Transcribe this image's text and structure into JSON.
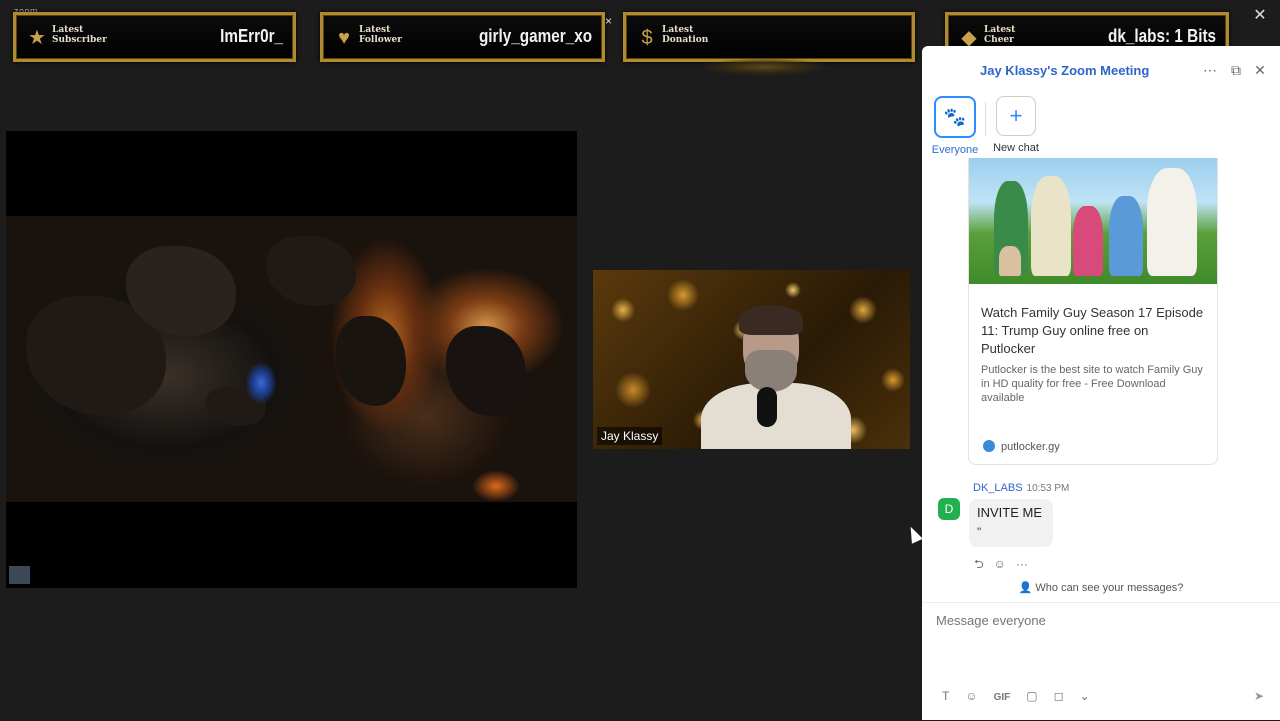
{
  "app": {
    "label": "zoom",
    "close_glyph": "✕"
  },
  "overlay": {
    "panels": [
      {
        "label": "Latest Subscriber",
        "value": "ImErr0r_"
      },
      {
        "label": "Latest Follower",
        "value": "girly_gamer_xo"
      },
      {
        "label": "Latest Donation",
        "value": ""
      },
      {
        "label": "Latest Cheer",
        "value": "dk_labs: 1 Bits"
      }
    ],
    "close_glyph": "×"
  },
  "video": {
    "participant_name": "Jay Klassy"
  },
  "chat": {
    "title": "Jay Klassy's Zoom Meeting",
    "header_icons": {
      "more": "⋯",
      "popout": "⧉",
      "close": "✕"
    },
    "channels": [
      {
        "label": "Everyone",
        "icon": "paw-icon",
        "glyph": "🐾"
      },
      {
        "label": "New chat",
        "icon": "plus-icon",
        "glyph": "+"
      }
    ],
    "link_card": {
      "title": "Watch Family Guy Season 17 Episode 11: Trump Guy online free on Putlocker",
      "description": "Putlocker is the best site to watch Family Guy in HD quality for free - Free Download available",
      "site": "putlocker.gy"
    },
    "message": {
      "avatar_letter": "D",
      "sender": "DK_LABS",
      "time": "10:53 PM",
      "text": "INVITE ME",
      "quote_mark": "\""
    },
    "reactions": {
      "reply": "⮌",
      "emoji": "☺",
      "more": "···"
    },
    "who_can_see": "Who can see your messages?",
    "composer": {
      "placeholder": "Message everyone",
      "tools": {
        "format": "T",
        "emoji": "☺",
        "gif": "GIF",
        "file": "▢",
        "screenshot": "◻",
        "dropdown": "⌄"
      },
      "send": "➤"
    }
  },
  "colors": {
    "accent": "#2d8cff",
    "gold": "#b08a2e",
    "avatar": "#21b04f"
  }
}
